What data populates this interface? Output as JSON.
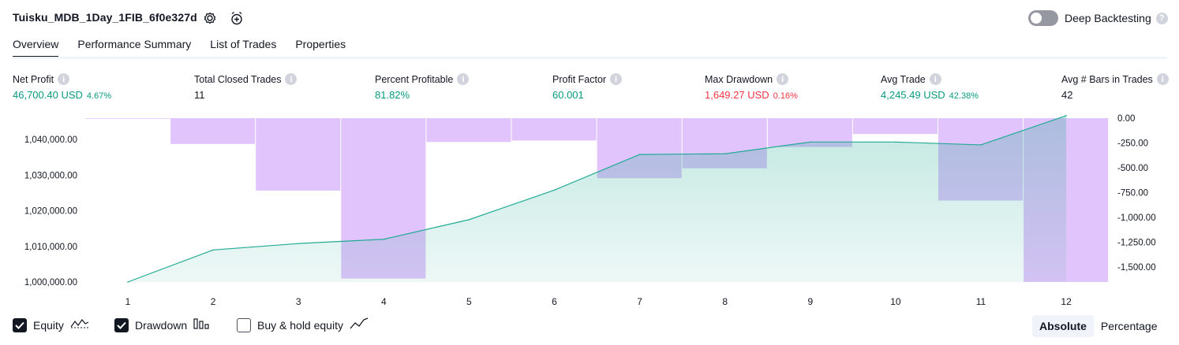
{
  "header": {
    "strategy_name": "Tuisku_MDB_1Day_1FIB_6f0e327d",
    "settings_icon": "gear-icon",
    "alert_icon": "alarm-clock-plus-icon",
    "deep_backtesting_label": "Deep Backtesting",
    "deep_backtesting_enabled": false,
    "help_glyph": "?"
  },
  "tabs": [
    {
      "label": "Overview",
      "active": true
    },
    {
      "label": "Performance Summary",
      "active": false
    },
    {
      "label": "List of Trades",
      "active": false
    },
    {
      "label": "Properties",
      "active": false
    }
  ],
  "metrics": [
    {
      "label": "Net Profit",
      "value": "46,700.40 USD",
      "pct": "4.67%",
      "color": "green"
    },
    {
      "label": "Total Closed Trades",
      "value": "11",
      "pct": "",
      "color": "black"
    },
    {
      "label": "Percent Profitable",
      "value": "81.82%",
      "pct": "",
      "color": "green"
    },
    {
      "label": "Profit Factor",
      "value": "60.001",
      "pct": "",
      "color": "green"
    },
    {
      "label": "Max Drawdown",
      "value": "1,649.27 USD",
      "pct": "0.16%",
      "color": "red"
    },
    {
      "label": "Avg Trade",
      "value": "4,245.49 USD",
      "pct": "42.38%",
      "color": "green"
    },
    {
      "label": "Avg # Bars in Trades",
      "value": "42",
      "pct": "",
      "color": "black"
    }
  ],
  "chart_data": {
    "type": "area",
    "x": [
      1,
      2,
      3,
      4,
      5,
      6,
      7,
      8,
      9,
      10,
      11,
      12
    ],
    "x_tick_labels": [
      "1",
      "2",
      "3",
      "4",
      "5",
      "6",
      "7",
      "8",
      "9",
      "10",
      "11",
      "12"
    ],
    "series": [
      {
        "values": [
          1000000,
          1009000,
          1010800,
          1012000,
          1017500,
          1025800,
          1035800,
          1036000,
          1039300,
          1039300,
          1038500,
          1046700
        ]
      }
    ],
    "drawdown": {
      "type": "bar",
      "values": [
        -5,
        -260,
        -730,
        -1615,
        -240,
        -225,
        -605,
        -505,
        -290,
        -160,
        -830,
        -1649.27,
        -1649.27
      ]
    },
    "left_axis": {
      "ylim": [
        1000000,
        1046000
      ],
      "tick_labels": [
        "1,040,000.00",
        "1,030,000.00",
        "1,020,000.00",
        "1,010,000.00",
        "1,000,000.00"
      ],
      "tick_values": [
        1040000,
        1030000,
        1020000,
        1010000,
        1000000
      ]
    },
    "right_axis": {
      "ylim": [
        -1650,
        0
      ],
      "tick_labels": [
        "0.00",
        "-250.00",
        "-500.00",
        "-750.00",
        "-1,000.00",
        "-1,250.00",
        "-1,500.00"
      ],
      "tick_values": [
        0,
        -250,
        -500,
        -750,
        -1000,
        -1250,
        -1500
      ]
    },
    "equity_color": "#22ab94",
    "drawdown_color": "#e1c4fb",
    "grid": false
  },
  "legend": {
    "equity": {
      "label": "Equity",
      "checked": true,
      "icon": "equity-line-icon"
    },
    "drawdown": {
      "label": "Drawdown",
      "checked": true,
      "icon": "drawdown-bars-icon"
    },
    "buy_hold": {
      "label": "Buy & hold equity",
      "checked": false,
      "icon": "buy-hold-line-icon"
    }
  },
  "view_toggle": {
    "absolute": "Absolute",
    "percentage": "Percentage",
    "active": "absolute"
  }
}
